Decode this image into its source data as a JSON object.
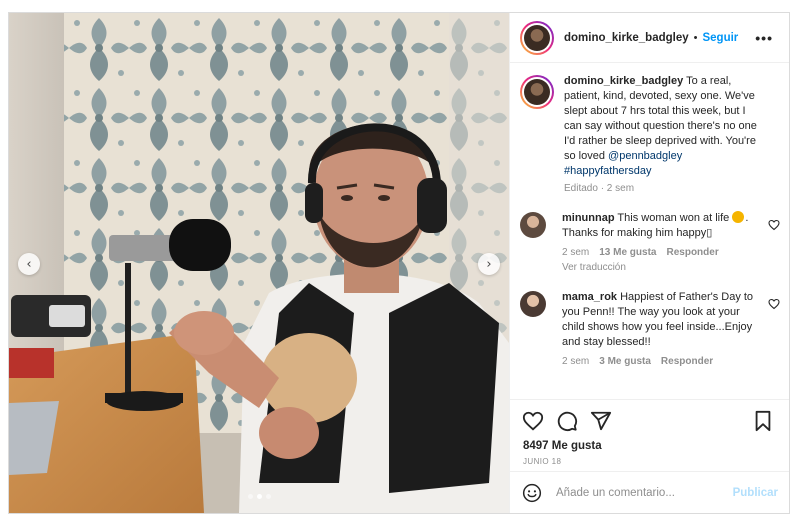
{
  "header": {
    "username": "domino_kirke_badgley",
    "separator": "•",
    "follow_label": "Seguir",
    "more_label": "•••"
  },
  "caption": {
    "username": "domino_kirke_badgley",
    "text": "To a real, patient, kind, devoted, sexy one. We've slept about 7 hrs total this week, but I can say without question there's no one I'd rather be sleep deprived with. You're so loved",
    "mention": "@pennbadgley",
    "hashtag": "#happyfathersday",
    "meta": "Editado · 2 sem"
  },
  "comments": [
    {
      "username": "minunnap",
      "text_before": "This woman won at life",
      "text_after": ". Thanks for making him happy▯",
      "time": "2 sem",
      "likes": "13 Me gusta",
      "reply_label": "Responder",
      "translate_label": "Ver traducción"
    },
    {
      "username": "mama_rok",
      "text": "Happiest of Father's Day to you Penn!! The way you look at your child shows how you feel inside...Enjoy and stay blessed!!",
      "time": "2 sem",
      "likes": "3 Me gusta",
      "reply_label": "Responder"
    }
  ],
  "actions": {
    "likes_count": "8497 Me gusta",
    "date": "JUNIO 18"
  },
  "add_comment": {
    "placeholder": "Añade un comentario...",
    "publish_label": "Publicar"
  },
  "media": {
    "prev_label": "‹",
    "next_label": "›",
    "slide_count": 3,
    "active_slide": 2
  },
  "icons": [
    "avatar",
    "more-options-icon",
    "heart-icon",
    "comment-icon",
    "share-icon",
    "bookmark-icon",
    "smiley-icon",
    "chevron-left-icon",
    "chevron-right-icon"
  ],
  "colors": {
    "follow_blue": "#0095f6",
    "publish_disabled": "#b2dffc",
    "muted_text": "#8e8e8e",
    "link": "#00376b"
  }
}
